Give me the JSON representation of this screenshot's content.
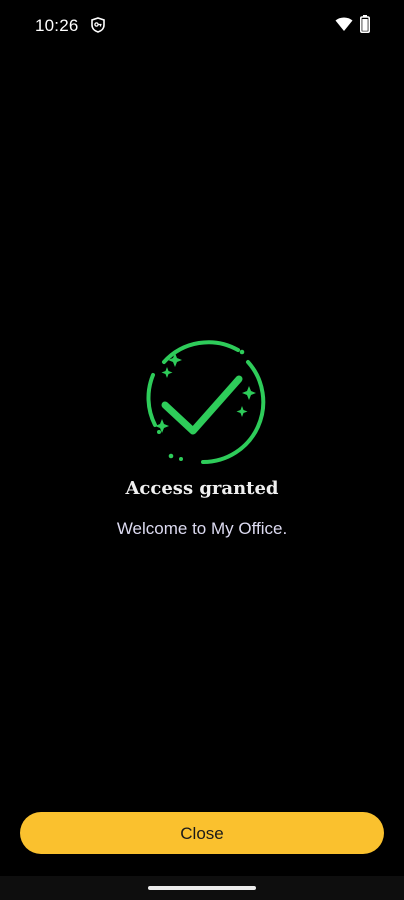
{
  "status_bar": {
    "time": "10:26",
    "vpn_icon": "vpn-key-icon",
    "wifi_icon": "wifi-icon",
    "battery_icon": "battery-icon"
  },
  "success": {
    "icon": "checkmark-sparkle-circle-icon",
    "accent_color": "#2ecc5a",
    "title": "Access granted",
    "message": "Welcome to My Office."
  },
  "actions": {
    "close_label": "Close",
    "button_color": "#fac12e"
  }
}
